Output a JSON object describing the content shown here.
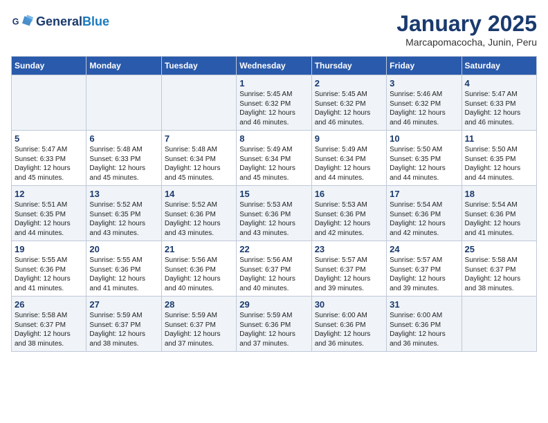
{
  "header": {
    "logo_line1": "General",
    "logo_line2": "Blue",
    "month": "January 2025",
    "location": "Marcapomacocha, Junin, Peru"
  },
  "weekdays": [
    "Sunday",
    "Monday",
    "Tuesday",
    "Wednesday",
    "Thursday",
    "Friday",
    "Saturday"
  ],
  "weeks": [
    [
      {
        "day": "",
        "info": ""
      },
      {
        "day": "",
        "info": ""
      },
      {
        "day": "",
        "info": ""
      },
      {
        "day": "1",
        "info": "Sunrise: 5:45 AM\nSunset: 6:32 PM\nDaylight: 12 hours\nand 46 minutes."
      },
      {
        "day": "2",
        "info": "Sunrise: 5:45 AM\nSunset: 6:32 PM\nDaylight: 12 hours\nand 46 minutes."
      },
      {
        "day": "3",
        "info": "Sunrise: 5:46 AM\nSunset: 6:32 PM\nDaylight: 12 hours\nand 46 minutes."
      },
      {
        "day": "4",
        "info": "Sunrise: 5:47 AM\nSunset: 6:33 PM\nDaylight: 12 hours\nand 46 minutes."
      }
    ],
    [
      {
        "day": "5",
        "info": "Sunrise: 5:47 AM\nSunset: 6:33 PM\nDaylight: 12 hours\nand 45 minutes."
      },
      {
        "day": "6",
        "info": "Sunrise: 5:48 AM\nSunset: 6:33 PM\nDaylight: 12 hours\nand 45 minutes."
      },
      {
        "day": "7",
        "info": "Sunrise: 5:48 AM\nSunset: 6:34 PM\nDaylight: 12 hours\nand 45 minutes."
      },
      {
        "day": "8",
        "info": "Sunrise: 5:49 AM\nSunset: 6:34 PM\nDaylight: 12 hours\nand 45 minutes."
      },
      {
        "day": "9",
        "info": "Sunrise: 5:49 AM\nSunset: 6:34 PM\nDaylight: 12 hours\nand 44 minutes."
      },
      {
        "day": "10",
        "info": "Sunrise: 5:50 AM\nSunset: 6:35 PM\nDaylight: 12 hours\nand 44 minutes."
      },
      {
        "day": "11",
        "info": "Sunrise: 5:50 AM\nSunset: 6:35 PM\nDaylight: 12 hours\nand 44 minutes."
      }
    ],
    [
      {
        "day": "12",
        "info": "Sunrise: 5:51 AM\nSunset: 6:35 PM\nDaylight: 12 hours\nand 44 minutes."
      },
      {
        "day": "13",
        "info": "Sunrise: 5:52 AM\nSunset: 6:35 PM\nDaylight: 12 hours\nand 43 minutes."
      },
      {
        "day": "14",
        "info": "Sunrise: 5:52 AM\nSunset: 6:36 PM\nDaylight: 12 hours\nand 43 minutes."
      },
      {
        "day": "15",
        "info": "Sunrise: 5:53 AM\nSunset: 6:36 PM\nDaylight: 12 hours\nand 43 minutes."
      },
      {
        "day": "16",
        "info": "Sunrise: 5:53 AM\nSunset: 6:36 PM\nDaylight: 12 hours\nand 42 minutes."
      },
      {
        "day": "17",
        "info": "Sunrise: 5:54 AM\nSunset: 6:36 PM\nDaylight: 12 hours\nand 42 minutes."
      },
      {
        "day": "18",
        "info": "Sunrise: 5:54 AM\nSunset: 6:36 PM\nDaylight: 12 hours\nand 41 minutes."
      }
    ],
    [
      {
        "day": "19",
        "info": "Sunrise: 5:55 AM\nSunset: 6:36 PM\nDaylight: 12 hours\nand 41 minutes."
      },
      {
        "day": "20",
        "info": "Sunrise: 5:55 AM\nSunset: 6:36 PM\nDaylight: 12 hours\nand 41 minutes."
      },
      {
        "day": "21",
        "info": "Sunrise: 5:56 AM\nSunset: 6:36 PM\nDaylight: 12 hours\nand 40 minutes."
      },
      {
        "day": "22",
        "info": "Sunrise: 5:56 AM\nSunset: 6:37 PM\nDaylight: 12 hours\nand 40 minutes."
      },
      {
        "day": "23",
        "info": "Sunrise: 5:57 AM\nSunset: 6:37 PM\nDaylight: 12 hours\nand 39 minutes."
      },
      {
        "day": "24",
        "info": "Sunrise: 5:57 AM\nSunset: 6:37 PM\nDaylight: 12 hours\nand 39 minutes."
      },
      {
        "day": "25",
        "info": "Sunrise: 5:58 AM\nSunset: 6:37 PM\nDaylight: 12 hours\nand 38 minutes."
      }
    ],
    [
      {
        "day": "26",
        "info": "Sunrise: 5:58 AM\nSunset: 6:37 PM\nDaylight: 12 hours\nand 38 minutes."
      },
      {
        "day": "27",
        "info": "Sunrise: 5:59 AM\nSunset: 6:37 PM\nDaylight: 12 hours\nand 38 minutes."
      },
      {
        "day": "28",
        "info": "Sunrise: 5:59 AM\nSunset: 6:37 PM\nDaylight: 12 hours\nand 37 minutes."
      },
      {
        "day": "29",
        "info": "Sunrise: 5:59 AM\nSunset: 6:36 PM\nDaylight: 12 hours\nand 37 minutes."
      },
      {
        "day": "30",
        "info": "Sunrise: 6:00 AM\nSunset: 6:36 PM\nDaylight: 12 hours\nand 36 minutes."
      },
      {
        "day": "31",
        "info": "Sunrise: 6:00 AM\nSunset: 6:36 PM\nDaylight: 12 hours\nand 36 minutes."
      },
      {
        "day": "",
        "info": ""
      }
    ]
  ]
}
